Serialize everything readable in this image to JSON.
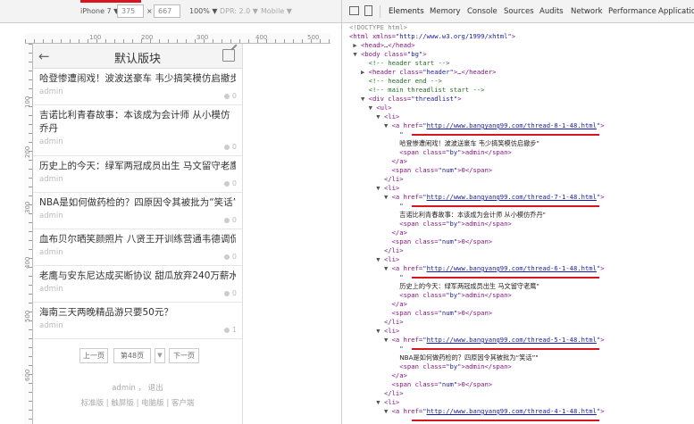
{
  "toolbar": {
    "device": "iPhone 7 ▼",
    "width": "375",
    "times": "×",
    "height": "667",
    "zoom": "100% ▼",
    "dpr": "DPR: 2.0 ▼",
    "mode": "Mobile ▼"
  },
  "ruler": {
    "ticks": [
      "100",
      "200",
      "300",
      "400",
      "500"
    ],
    "vticks": [
      "100",
      "200",
      "300",
      "400",
      "500",
      "600"
    ]
  },
  "header": {
    "back": "←",
    "title": "默认版块"
  },
  "threads": [
    {
      "title": "哈登惨遭闹戏！波波送豪车 韦少搞笑模仿启撤步",
      "by": "admin",
      "num": "0"
    },
    {
      "title": "吉诺比利青春故事：本该成为会计师 从小模仿乔丹",
      "by": "admin",
      "num": "0"
    },
    {
      "title": "历史上的今天：绿军两冠成员出生 马文留守老鹰",
      "by": "admin",
      "num": "0"
    },
    {
      "title": "NBA是如何做药检的？四原因令其被批为“笑话”",
      "by": "admin",
      "num": "0"
    },
    {
      "title": "血布贝尔晒笑颜照片 八贤王开训练营通韦德调侃",
      "by": "admin",
      "num": "0"
    },
    {
      "title": "老鹰与安东尼达成买断协议 甜瓜放弃240万薪水",
      "by": "admin",
      "num": "0"
    },
    {
      "title": "海南三天两晚精品游只要50元？",
      "by": "admin",
      "num": "1"
    }
  ],
  "pager": {
    "prev": "上一页",
    "page": "第48页",
    "arrow": "▼",
    "next": "下一页"
  },
  "footer": {
    "user": "admin ， 退出",
    "links": "标准版 | 触屏版 | 电脑版 | 客户端"
  },
  "devtools": {
    "tabs": [
      "Elements",
      "Memory",
      "Console",
      "Sources",
      "Audits",
      "Network",
      "Performance",
      "Application"
    ],
    "code": {
      "doctype": "<!DOCTYPE html>",
      "html_open_a": "<html xmlns=",
      "html_xmlns": "\"http://www.w3.org/1999/xhtml\"",
      "html_open_b": ">",
      "head": "<head>…</head>",
      "body_a": "<body class=",
      "body_cls": "\"bg\"",
      "body_b": ">",
      "c_header_start": "<!-- header start -->",
      "header_a": "<header class=",
      "header_cls": "\"header\"",
      "header_b": ">…</header>",
      "c_header_end": "<!-- header end -->",
      "c_main": "<!-- main threadlist start -->",
      "div_a": "<div class=",
      "div_cls": "\"threadlist\"",
      "div_b": ">",
      "ul": "<ul>",
      "li": "<li>",
      "li_close": "</li>",
      "a_a": "<a href=",
      "a_b": ">",
      "a_close": "</a>",
      "span_by_a": "<span class=",
      "span_by_cls": "\"by\"",
      "span_by_b": ">admin</span>",
      "span_num_a": "<span class=",
      "span_num_cls": "\"num\"",
      "span_num_b": ">0</span>",
      "quote": "\"",
      "items": [
        {
          "href": "http://www.bangyang99.com/thread-8-1-48.html",
          "text": "哈登惨遭闹戏！波波送豪车 韦少搞笑模仿启撤步\""
        },
        {
          "href": "http://www.bangyang99.com/thread-7-1-48.html",
          "text": "吉诺比利青春故事：本该成为会计师 从小模仿乔丹\""
        },
        {
          "href": "http://www.bangyang99.com/thread-6-1-48.html",
          "text": "历史上的今天：绿军两冠成员出生 马文留守老鹰\""
        },
        {
          "href": "http://www.bangyang99.com/thread-5-1-48.html",
          "text": "NBA是如何做药检的？四原因令其被批为“笑话”\""
        },
        {
          "href": "http://www.bangyang99.com/thread-4-1-48.html"
        }
      ]
    }
  }
}
